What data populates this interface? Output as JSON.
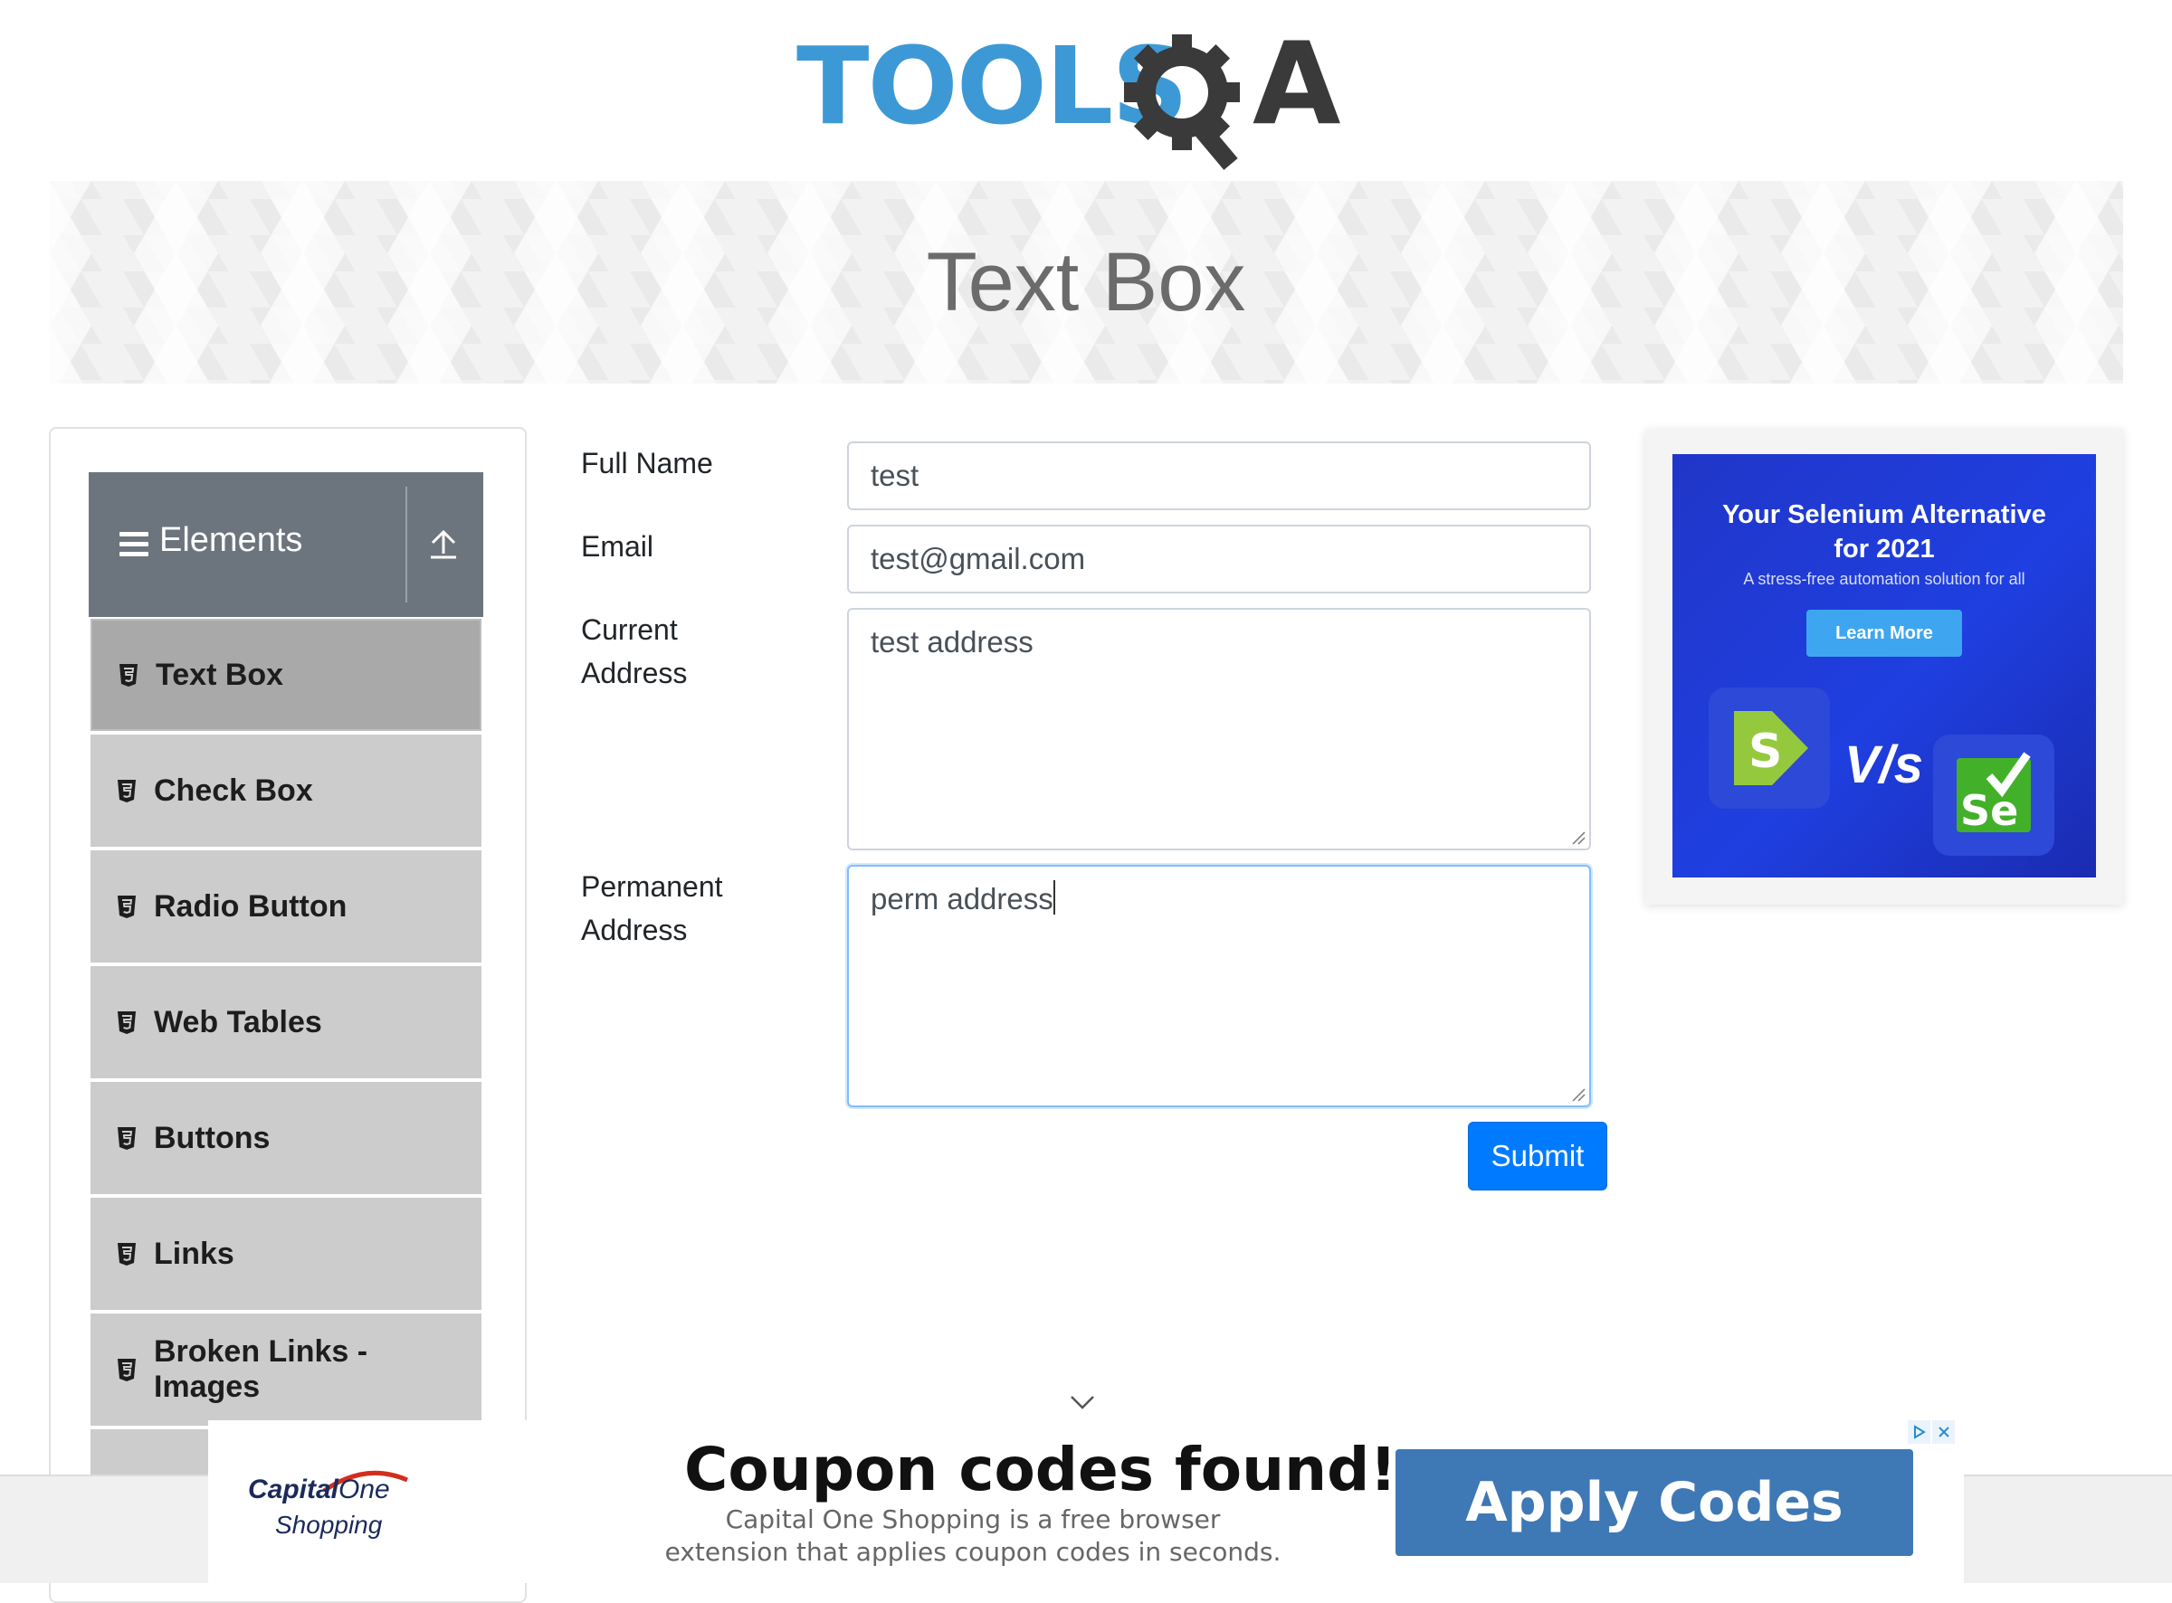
{
  "logo": {
    "text": "TOOLS",
    "letter": "A",
    "brand_color": "#3d99d5",
    "icon": "gear-magnifier-icon"
  },
  "banner": {
    "title": "Text Box"
  },
  "sidebar": {
    "group": {
      "title": "Elements",
      "icon": "hamburger-icon",
      "toggle_icon": "collapse-arrow-icon"
    },
    "items": [
      {
        "label": "Text Box",
        "active": true
      },
      {
        "label": "Check Box"
      },
      {
        "label": "Radio Button"
      },
      {
        "label": "Web Tables"
      },
      {
        "label": "Buttons"
      },
      {
        "label": "Links"
      },
      {
        "label": "Broken Links - Images"
      }
    ],
    "active_color": "#a9a9a9",
    "item_color": "#cccccc",
    "header_color": "#6c757d"
  },
  "form": {
    "full_name": {
      "label": "Full Name",
      "value": "test"
    },
    "email": {
      "label": "Email",
      "value": "test@gmail.com"
    },
    "current_address": {
      "label_line1": "Current",
      "label_line2": "Address",
      "value": "test address"
    },
    "permanent_address": {
      "label_line1": "Permanent",
      "label_line2": "Address",
      "value": "perm address"
    },
    "submit_label": "Submit",
    "submit_color": "#007bff"
  },
  "right_ad": {
    "title_line1": "Your Selenium Alternative",
    "title_line2": "for 2021",
    "subtitle": "A stress-free automation solution for all",
    "button_label": "Learn More",
    "s_logo": "S",
    "vs": "V/s",
    "se_logo": "Se"
  },
  "bottom_ad": {
    "brand_line1": "Capital",
    "brand_line1b": "One",
    "brand_line2": "Shopping",
    "headline": "Coupon codes found!",
    "body": "Capital One Shopping is a free browser extension that applies coupon codes in seconds.",
    "button_label": "Apply Codes",
    "button_color": "#3e78b5"
  }
}
